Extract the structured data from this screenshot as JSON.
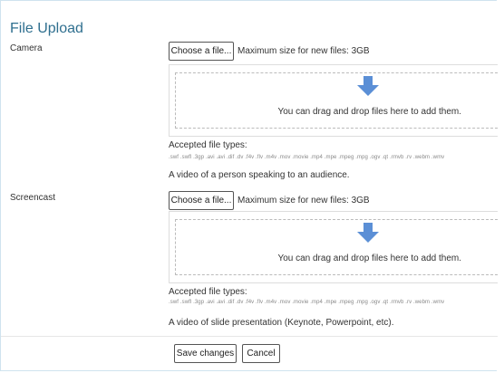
{
  "page": {
    "title": "File Upload",
    "colors": {
      "title": "#2f6f8f",
      "arrow": "#5b8fd6"
    }
  },
  "camera": {
    "label": "Camera",
    "choose_label": "Choose a file...",
    "max_size": "Maximum size for new files: 3GB",
    "drop_text": "You can drag and drop files here to add them.",
    "accepted_label": "Accepted file types:",
    "accepted_list": ".swf .swfl .3gp .avi .avi .dif .dv .f4v .flv .m4v .mov .movie .mp4 .mpe .mpeg .mpg .ogv .qt .rmvb .rv .webm .wmv",
    "description": "A video of a person speaking to an audience."
  },
  "screencast": {
    "label": "Screencast",
    "choose_label": "Choose a file...",
    "max_size": "Maximum size for new files: 3GB",
    "drop_text": "You can drag and drop files here to add them.",
    "accepted_label": "Accepted file types:",
    "accepted_list": ".swf .swfl .3gp .avi .avi .dif .dv .f4v .flv .m4v .mov .movie .mp4 .mpe .mpeg .mpg .ogv .qt .rmvb .rv .webm .wmv",
    "description": "A video of slide presentation (Keynote, Powerpoint, etc)."
  },
  "actions": {
    "save_label": "Save changes",
    "cancel_label": "Cancel"
  }
}
